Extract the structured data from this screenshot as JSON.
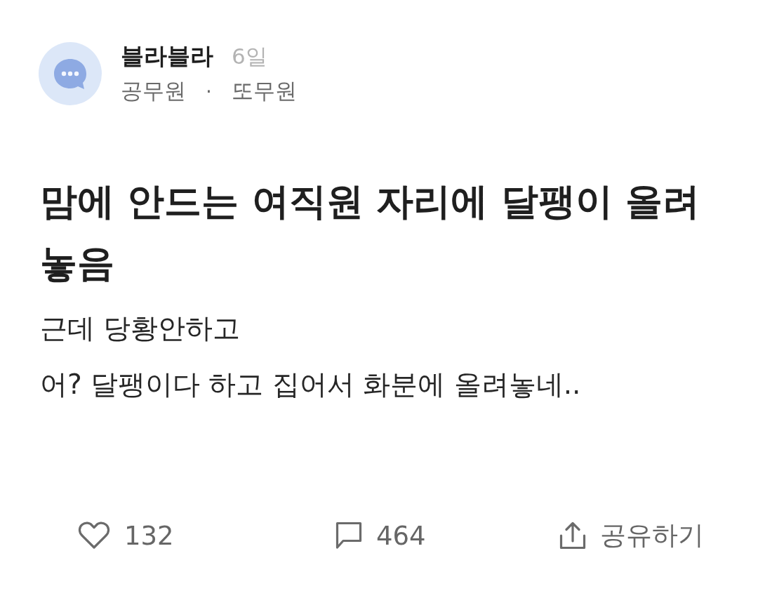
{
  "post": {
    "author": {
      "name": "블라블라",
      "time": "6일",
      "company": "공무원",
      "separator": "·",
      "nickname": "또무원"
    },
    "title": "맘에 안드는 여직원 자리에 달팽이 올려놓음",
    "body": [
      "근데 당황안하고",
      "어? 달팽이다 하고 집어서 화분에 올려놓네.."
    ]
  },
  "actions": [
    {
      "kind": "like",
      "label": "132"
    },
    {
      "kind": "comment",
      "label": "464"
    },
    {
      "kind": "share",
      "label": "공유하기"
    }
  ]
}
